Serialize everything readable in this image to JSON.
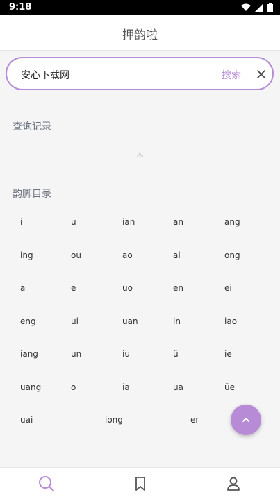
{
  "status_bar": {
    "time": "9:18"
  },
  "app": {
    "title": "押韵啦"
  },
  "search": {
    "value": "安心下载网",
    "button_label": "搜索"
  },
  "history": {
    "title": "查询记录",
    "empty_text": "无"
  },
  "rhymes": {
    "title": "韵脚目录",
    "rows": [
      [
        "i",
        "u",
        "ian",
        "an",
        "ang"
      ],
      [
        "ing",
        "ou",
        "ao",
        "ai",
        "ong"
      ],
      [
        "a",
        "e",
        "uo",
        "en",
        "ei"
      ],
      [
        "eng",
        "ui",
        "uan",
        "in",
        "iao"
      ],
      [
        "iang",
        "un",
        "iu",
        "ü",
        "ie"
      ],
      [
        "uang",
        "o",
        "ia",
        "ua",
        "üe"
      ],
      [
        "uai",
        "iong",
        "er"
      ]
    ]
  },
  "colors": {
    "accent": "#b78bd6",
    "text": "#333333",
    "muted": "#6b7280"
  },
  "icons": {
    "fab": "chevron-up-icon",
    "tabs": [
      "search-icon",
      "bookmark-icon",
      "person-icon"
    ]
  }
}
